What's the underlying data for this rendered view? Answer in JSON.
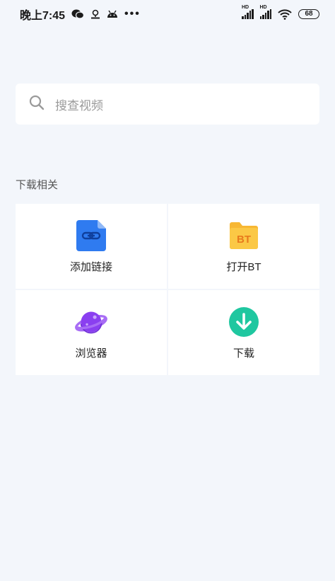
{
  "status_bar": {
    "time": "晚上7:45",
    "battery": "68",
    "icons": [
      "wechat-icon",
      "location-pin-icon",
      "android-icon",
      "signal-hd-icon",
      "wifi-icon"
    ]
  },
  "search": {
    "placeholder": "搜查视频",
    "icon": "search-icon"
  },
  "section": {
    "title": "下载相关",
    "items": [
      {
        "label": "添加链接",
        "icon": "link-file-icon",
        "color": "#2f7bf0"
      },
      {
        "label": "打开BT",
        "icon": "bt-folder-icon",
        "color": "#f7b733"
      },
      {
        "label": "浏览器",
        "icon": "planet-browser-icon",
        "color": "#8a3ff0"
      },
      {
        "label": "下载",
        "icon": "download-arrow-icon",
        "color": "#1fc7a0"
      }
    ]
  },
  "colors": {
    "background": "#f3f6fb",
    "card": "#ffffff"
  }
}
